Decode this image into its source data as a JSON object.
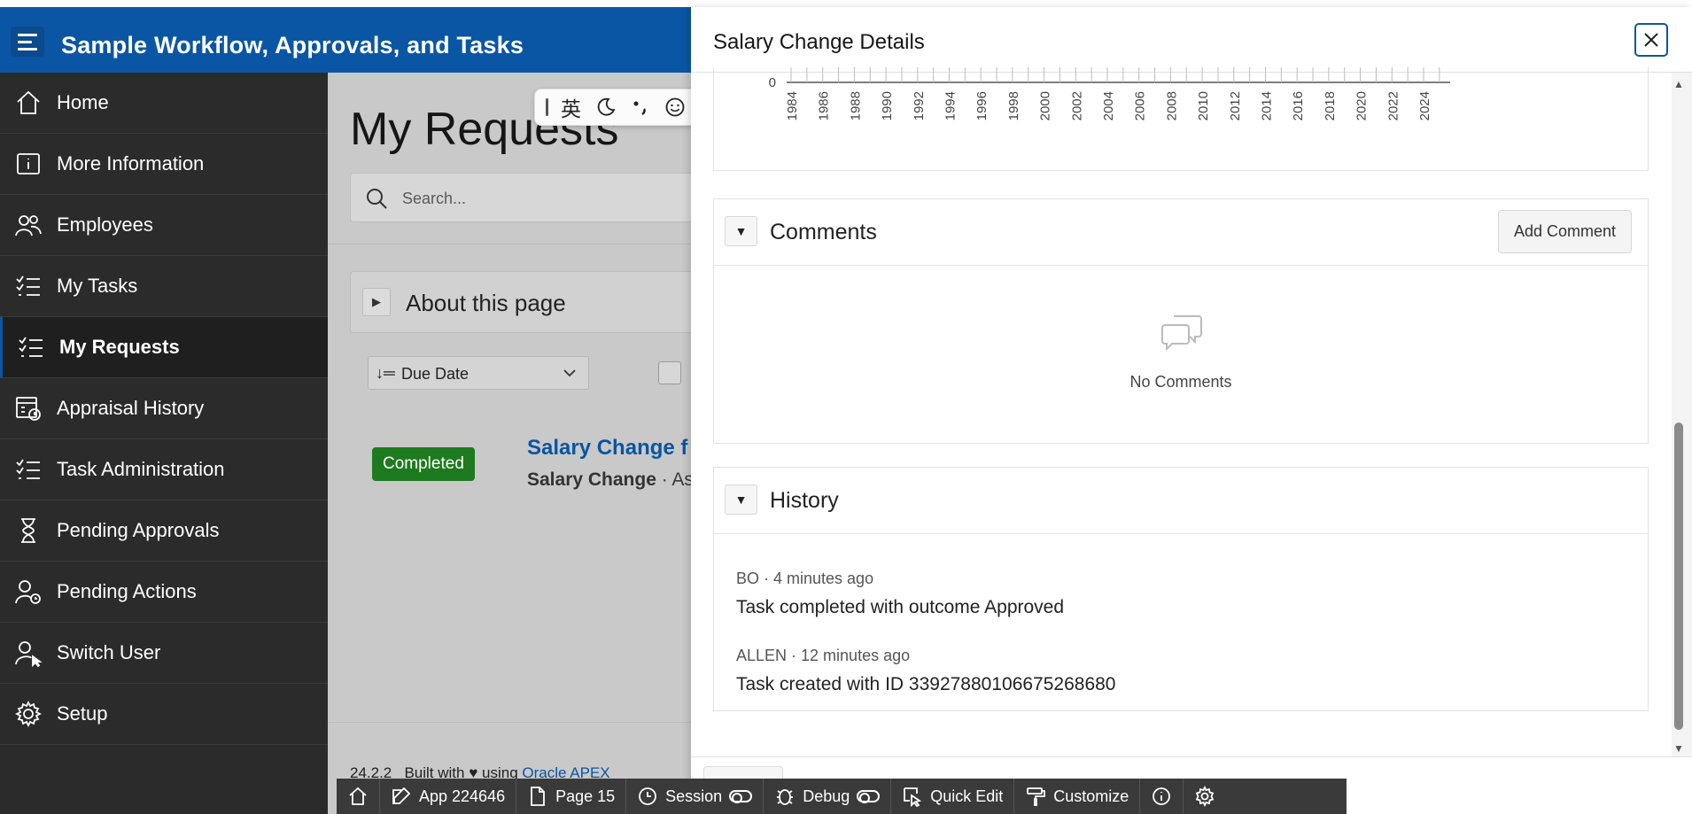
{
  "app": {
    "title": "Sample Workflow, Approvals, and Tasks"
  },
  "sidebar": {
    "items": [
      {
        "label": "Home",
        "icon": "home-icon"
      },
      {
        "label": "More Information",
        "icon": "info-icon"
      },
      {
        "label": "Employees",
        "icon": "people-icon"
      },
      {
        "label": "My Tasks",
        "icon": "checklist-icon"
      },
      {
        "label": "My Requests",
        "icon": "checklist-icon",
        "active": true
      },
      {
        "label": "Appraisal History",
        "icon": "calendar-history-icon"
      },
      {
        "label": "Task Administration",
        "icon": "checklist-icon"
      },
      {
        "label": "Pending Approvals",
        "icon": "hourglass-icon"
      },
      {
        "label": "Pending Actions",
        "icon": "user-clock-icon"
      },
      {
        "label": "Switch User",
        "icon": "user-switch-icon"
      },
      {
        "label": "Setup",
        "icon": "gear-icon"
      }
    ]
  },
  "main": {
    "title": "My Requests",
    "search_placeholder": "Search...",
    "about_label": "About this page",
    "sort_label": "Due Date",
    "badge": "Completed",
    "request_title": "Salary Change f",
    "request_type": "Salary Change",
    "request_sub": " · As",
    "footer_version": "24.2.2",
    "footer_text": "Built with",
    "footer_using": "using",
    "footer_link": "Oracle APEX"
  },
  "ime_toolbar": {
    "lang": "英"
  },
  "dialog": {
    "title": "Salary Change Details",
    "chart": {
      "zero_label": "0",
      "years": [
        "1984",
        "1986",
        "1988",
        "1990",
        "1992",
        "1994",
        "1996",
        "1998",
        "2000",
        "2002",
        "2004",
        "2006",
        "2008",
        "2010",
        "2012",
        "2014",
        "2016",
        "2018",
        "2020",
        "2022",
        "2024"
      ]
    },
    "comments": {
      "title": "Comments",
      "add_button": "Add Comment",
      "empty_text": "No Comments"
    },
    "history": {
      "title": "History",
      "entries": [
        {
          "meta": "BO · 4 minutes ago",
          "text": "Task completed with outcome Approved"
        },
        {
          "meta": "ALLEN · 12 minutes ago",
          "text": "Task created with ID 33927880106675268680"
        }
      ]
    }
  },
  "devbar": {
    "app": "App 224646",
    "page": "Page 15",
    "session": "Session",
    "debug": "Debug",
    "quick_edit": "Quick Edit",
    "customize": "Customize"
  }
}
